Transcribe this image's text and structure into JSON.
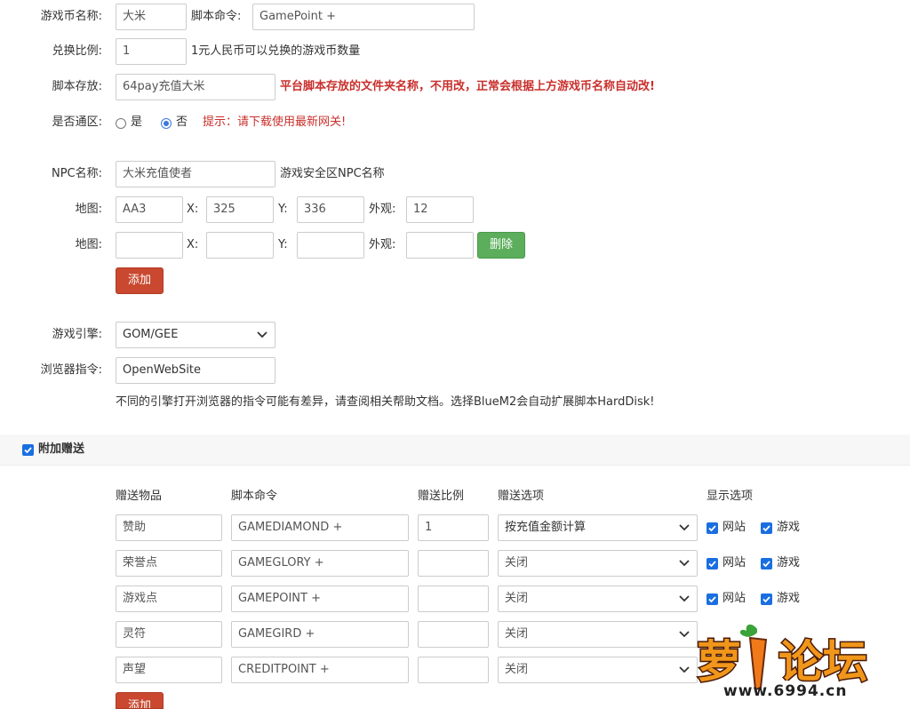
{
  "form": {
    "coin_name_label": "游戏币名称:",
    "coin_name_value": "大米",
    "script_cmd_label": "脚本命令:",
    "script_cmd_value": "GamePoint +",
    "ratio_label": "兑换比例:",
    "ratio_value": "1",
    "ratio_hint": "1元人民币可以兑换的游戏币数量",
    "script_store_label": "脚本存放:",
    "script_store_value": "64pay充值大米",
    "script_store_hint": "平台脚本存放的文件夹名称，不用改，正常会根据上方游戏币名称自动改!",
    "universal_label": "是否通区:",
    "universal_yes": "是",
    "universal_no": "否",
    "universal_tip": "提示：请下载使用最新网关!",
    "npc_label": "NPC名称:",
    "npc_value": "大米充值使者",
    "npc_hint": "游戏安全区NPC名称",
    "map_label": "地图:",
    "x_label": "X:",
    "y_label": "Y:",
    "look_label": "外观:",
    "map1": {
      "map": "AA3",
      "x": "325",
      "y": "336",
      "look": "12"
    },
    "map2": {
      "map": "",
      "x": "",
      "y": "",
      "look": ""
    },
    "delete_button": "删除",
    "add_button": "添加",
    "engine_label": "游戏引擎:",
    "engine_value": "GOM/GEE",
    "browser_cmd_label": "浏览器指令:",
    "browser_cmd_value": "OpenWebSite",
    "engine_note": "不同的引擎打开浏览器的指令可能有差异，请查阅相关帮助文档。选择BlueM2会自动扩展脚本HardDisk!"
  },
  "bonus": {
    "section_title": "附加赠送",
    "section_checked": true,
    "headers": {
      "item": "赠送物品",
      "cmd": "脚本命令",
      "ratio": "赠送比例",
      "option": "赠送选项",
      "display": "显示选项"
    },
    "site_label": "网站",
    "game_label": "游戏",
    "rows": [
      {
        "item": "赞助",
        "cmd": "GAMEDIAMOND +",
        "ratio": "1",
        "option": "按充值金额计算"
      },
      {
        "item": "荣誉点",
        "cmd": "GAMEGLORY +",
        "ratio": "",
        "option": "关闭"
      },
      {
        "item": "游戏点",
        "cmd": "GAMEPOINT +",
        "ratio": "",
        "option": "关闭"
      },
      {
        "item": "灵符",
        "cmd": "GAMEGIRD +",
        "ratio": "",
        "option": "关闭"
      },
      {
        "item": "声望",
        "cmd": "CREDITPOINT +",
        "ratio": "",
        "option": "关闭"
      }
    ],
    "add_button": "添加"
  },
  "watermark": {
    "text": "萝卜论坛",
    "url": "www.6994.cn"
  },
  "colors": {
    "accent_red": "#c9482f",
    "accent_green": "#5cae5c",
    "checkbox_blue": "#1a6fe0",
    "warning_red": "#c9302c"
  }
}
